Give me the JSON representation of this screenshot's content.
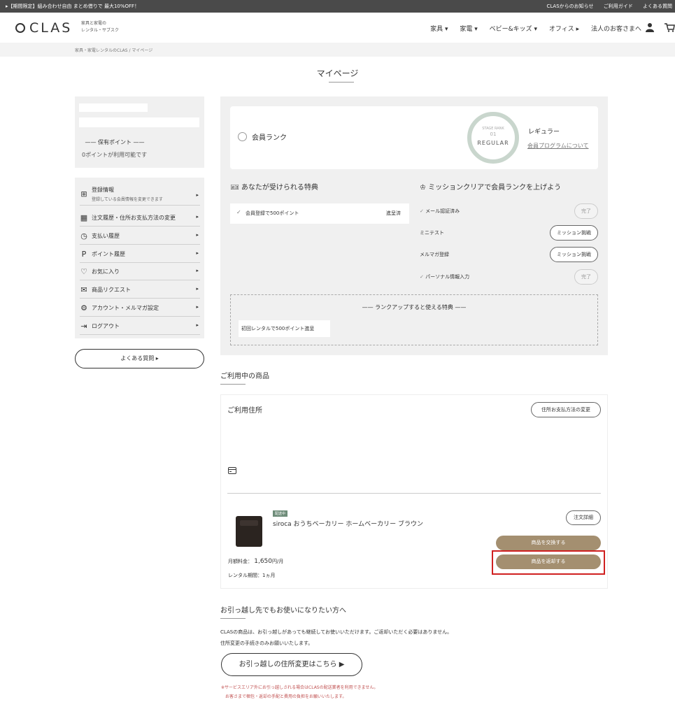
{
  "topbar": {
    "promo": "▸【期間限定】組み合わせ自由 まとめ借りで 最大10%OFF！",
    "links": [
      "CLASからのお知らせ",
      "ご利用ガイド",
      "よくある質問"
    ]
  },
  "header": {
    "logo": "CLAS",
    "tagline": "家具と家電の\nレンタル・サブスク",
    "nav": [
      "家具 ▾",
      "家電 ▾",
      "ベビー&キッズ ▾",
      "オフィス ▸",
      "法人のお客さまへ"
    ],
    "icons": [
      "user-icon",
      "cart-icon"
    ]
  },
  "breadcrumb": "家具・家電レンタルのCLAS  /  マイページ",
  "page_title": "マイページ",
  "sidebar": {
    "points_heading": "—— 保有ポイント ——",
    "points_text": "0ポイントが利用可能です",
    "menu": [
      {
        "label": "登録情報",
        "sub": "登録している会員情報を変更できます",
        "icon": "doc-icon",
        "glyph": "⊞"
      },
      {
        "label": "注文履歴・住所お支払方法の変更",
        "icon": "calendar-icon",
        "glyph": "▦"
      },
      {
        "label": "支払い履歴",
        "icon": "history-icon",
        "glyph": "◷"
      },
      {
        "label": "ポイント履歴",
        "icon": "point-icon",
        "glyph": "P"
      },
      {
        "label": "お気に入り",
        "icon": "heart-icon",
        "glyph": "♡"
      },
      {
        "label": "商品リクエスト",
        "icon": "mail-icon",
        "glyph": "✉"
      },
      {
        "label": "アカウント・メルマガ設定",
        "icon": "gear-icon",
        "glyph": "⚙"
      },
      {
        "label": "ログアウト",
        "icon": "logout-icon",
        "glyph": "⇥"
      }
    ],
    "faq_button": "よくある質問 ▸"
  },
  "rank": {
    "label": "会員ランク",
    "badge_line1": "STAGE RANK",
    "badge_line2": "01",
    "badge_line3": "REGULAR",
    "name": "レギュラー",
    "program_link": "会員プログラムについて"
  },
  "benefits": {
    "heading": "あなたが受けられる特典",
    "items": [
      {
        "text": "会員登録で500ポイント",
        "status": "進呈済"
      }
    ]
  },
  "missions": {
    "heading": "ミッションクリアで会員ランクを上げよう",
    "items": [
      {
        "text": "メール認証済み",
        "button": "完了",
        "done": true
      },
      {
        "text": "ミニテスト",
        "button": "ミッション挑戦",
        "done": false
      },
      {
        "text": "メルマガ登録",
        "button": "ミッション挑戦",
        "done": false
      },
      {
        "text": "パーソナル情報入力",
        "button": "完了",
        "done": true
      }
    ]
  },
  "rankup": {
    "heading": "—— ランクアップすると使える特典 ——",
    "tag": "初回レンタルで500ポイント進呈"
  },
  "in_use": {
    "section_title": "ご利用中の商品",
    "card_title": "ご利用住所",
    "address_button": "住所お支払方法の変更",
    "product": {
      "badge": "配送中",
      "name": "siroca おうちベーカリー ホームベーカリー ブラウン",
      "fee_label": "月額料金：",
      "fee_value": "1,650",
      "fee_unit": "円/月",
      "period": "レンタル期間：1ヵ月"
    },
    "order_button": "注文詳細",
    "exchange_button": "商品を交換する",
    "return_button": "商品を返却する"
  },
  "moving": {
    "title": "お引っ越し先でもお使いになりたい方へ",
    "line1": "CLASの商品は、お引っ越しがあっても継続してお使いいただけます。ご返却いただく必要はありません。",
    "line2": "住所変更の手続きのみお願いいたします。",
    "button": "お引っ越しの住所変更はこちら ▶",
    "note1": "※サービスエリア外にお引っ越しされる場合はCLASの配送業者を利用できません。",
    "note2": "お客さまで梱包・返却の手配と費用の負担をお願いいたします。"
  }
}
